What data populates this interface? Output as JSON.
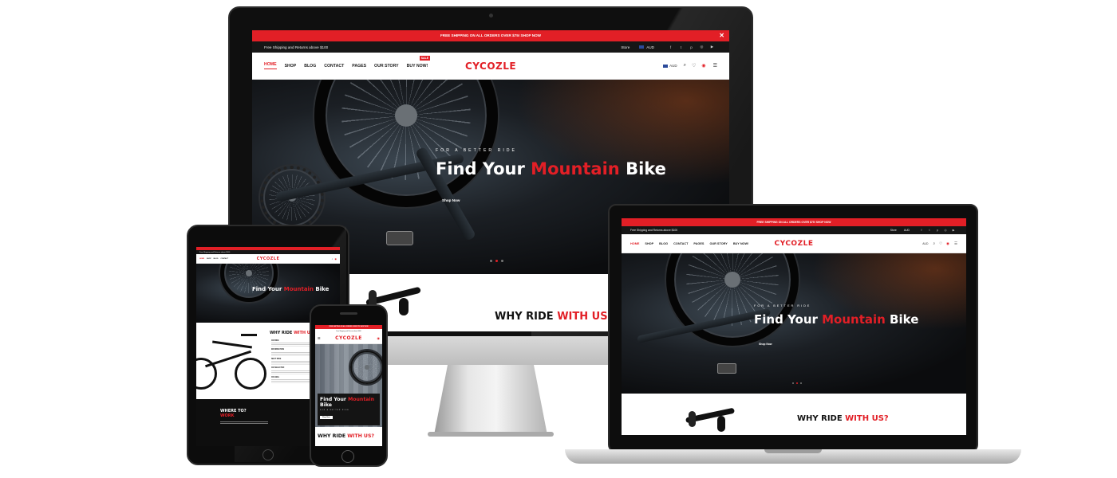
{
  "site": {
    "logo": "CYCOZLE",
    "promo": "FREE SHIPPING ON ALL ORDERS OVER $75! SHOP NOW",
    "utility_left": "Free Shipping and Returns above $100",
    "store_label": "Store",
    "currency": "AUD",
    "nav": [
      "HOME",
      "SHOP",
      "BLOG",
      "CONTACT",
      "PAGES",
      "OUR STORY",
      "BUY NOW!"
    ],
    "sale_badge": "SALE",
    "hero_eyebrow": "FOR A BETTER RIDE",
    "hero_title_1": "Find Your ",
    "hero_title_red": "Mountain",
    "hero_title_2": " Bike",
    "hero_button": "Shop Now",
    "why_1": "WHY RIDE ",
    "why_red": "WITH US?",
    "where_1": "WHERE TO?",
    "where_red": "WORK",
    "mobile_title_1": "Find Your ",
    "mobile_title_red": "Mountain",
    "mobile_title_2": "Bike",
    "mobile_why_1": "WHY RIDE ",
    "mobile_why_red": "WITH US?",
    "features": [
      "ON BIKE",
      "INFORMATION",
      "NEXT RIDE",
      "ON SELECTED",
      "ON HEEL"
    ]
  },
  "social_icons": [
    "facebook-icon",
    "twitter-icon",
    "pinterest-icon",
    "instagram-icon",
    "youtube-icon"
  ],
  "colors": {
    "accent": "#e21f26",
    "dark": "#161616"
  }
}
